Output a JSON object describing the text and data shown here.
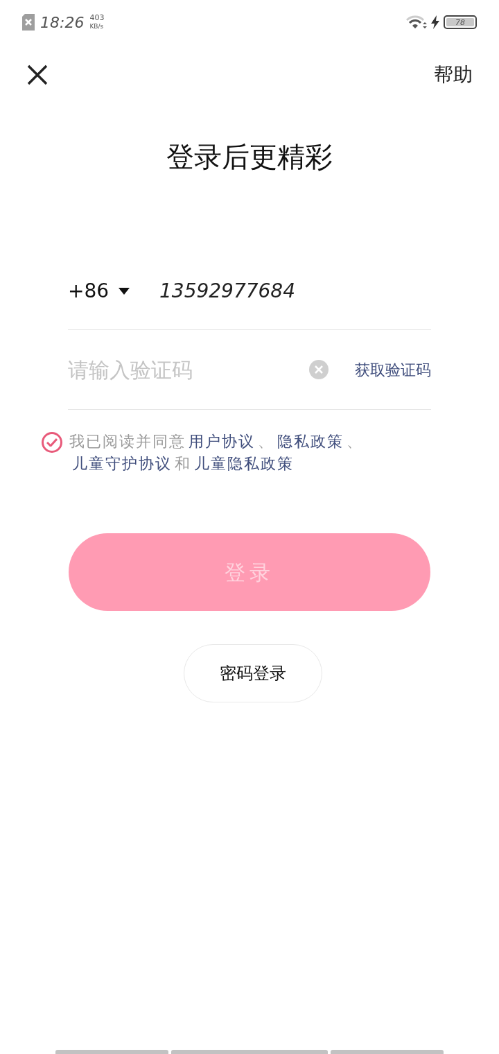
{
  "status_bar": {
    "time": "18:26",
    "speed": "403",
    "speed_unit": "KB/s",
    "battery": "78"
  },
  "header": {
    "help": "帮助"
  },
  "title": "登录后更精彩",
  "phone": {
    "country_code": "+86",
    "value": "13592977684"
  },
  "code": {
    "placeholder": "请输入验证码",
    "get_code": "获取验证码"
  },
  "agreement": {
    "checked": true,
    "segments": [
      {
        "kind": "text",
        "text": "我已阅读并同意"
      },
      {
        "kind": "link",
        "text": "用户协议"
      },
      {
        "kind": "text",
        "text": "、"
      },
      {
        "kind": "link",
        "text": "隐私政策"
      },
      {
        "kind": "text",
        "text": "、"
      },
      {
        "kind": "link",
        "text": "儿童守护协议"
      },
      {
        "kind": "text",
        "text": "和"
      },
      {
        "kind": "link",
        "text": "儿童隐私政策"
      }
    ]
  },
  "login_button": {
    "label": "登录",
    "disabled": true
  },
  "password_login": "密码登录"
}
